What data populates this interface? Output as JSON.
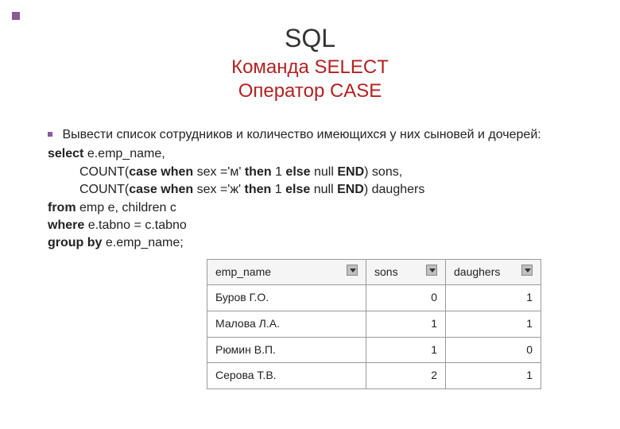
{
  "header": {
    "title_main": "SQL",
    "title_sub1": "Команда SELECT",
    "title_sub2": "Оператор CASE"
  },
  "body": {
    "task_text": "Вывести список сотрудников и количество имеющихся у них сыновей и дочерей:",
    "code": {
      "l1_kw": "select",
      "l1_rest": " e.emp_name,",
      "l2_p1": "COUNT(",
      "l2_kw1": "case when",
      "l2_mid": " sex ='м' ",
      "l2_kw2": "then",
      "l2_mid2": " 1 ",
      "l2_kw3": "else",
      "l2_mid3": " null ",
      "l2_kw4": "END",
      "l2_end": ") sons,",
      "l3_p1": "COUNT(",
      "l3_kw1": "case when",
      "l3_mid": " sex ='ж' ",
      "l3_kw2": "then",
      "l3_mid2": " 1 ",
      "l3_kw3": "else",
      "l3_mid3": " null ",
      "l3_kw4": "END",
      "l3_end": ") daughers",
      "l4_kw": "from",
      "l4_rest": " emp e, children c",
      "l5_kw": "where",
      "l5_rest": " e.tabno = c.tabno",
      "l6_kw": "group by",
      "l6_rest": " e.emp_name;"
    }
  },
  "table": {
    "headers": {
      "c0": "emp_name",
      "c1": "sons",
      "c2": "daughers"
    },
    "rows": [
      {
        "name": "Буров Г.О.",
        "sons": "0",
        "daughers": "1"
      },
      {
        "name": "Малова Л.А.",
        "sons": "1",
        "daughers": "1"
      },
      {
        "name": "Рюмин В.П.",
        "sons": "1",
        "daughers": "0"
      },
      {
        "name": "Серова Т.В.",
        "sons": "2",
        "daughers": "1"
      }
    ]
  },
  "chart_data": {
    "type": "table",
    "columns": [
      "emp_name",
      "sons",
      "daughers"
    ],
    "rows": [
      [
        "Буров Г.О.",
        0,
        1
      ],
      [
        "Малова Л.А.",
        1,
        1
      ],
      [
        "Рюмин В.П.",
        1,
        0
      ],
      [
        "Серова Т.В.",
        2,
        1
      ]
    ]
  }
}
